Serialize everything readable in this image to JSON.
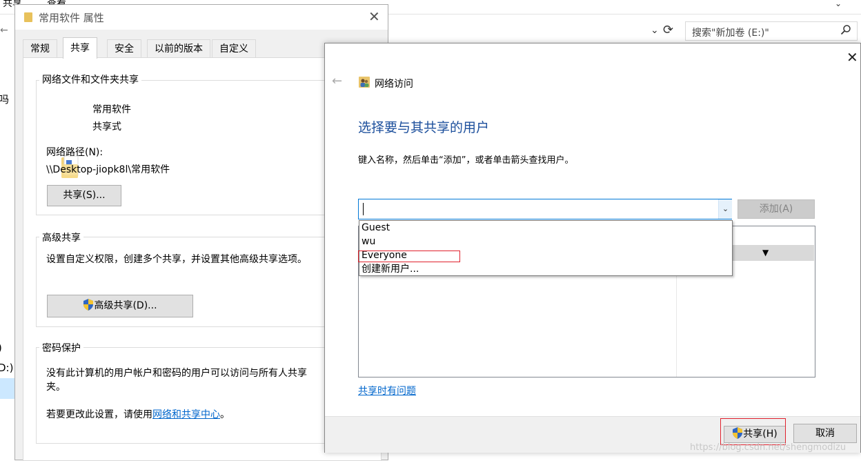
{
  "explorer": {
    "ribbon_tabs": [
      "共享",
      "查看"
    ],
    "search_placeholder": "搜索\"新加卷 (E:)\"",
    "sidebar_fragments": [
      "吗",
      ")",
      "D:)"
    ]
  },
  "properties": {
    "title": "常用软件 属性",
    "tabs": [
      "常规",
      "共享",
      "安全",
      "以前的版本",
      "自定义"
    ],
    "active_tab": "共享",
    "network_sharing": {
      "group_label": "网络文件和文件夹共享",
      "folder_name": "常用软件",
      "share_state": "共享式",
      "path_label": "网络路径(N):",
      "path_value": "\\\\Desktop-jiopk8l\\常用软件",
      "share_button": "共享(S)..."
    },
    "advanced": {
      "group_label": "高级共享",
      "description": "设置自定义权限，创建多个共享，并设置其他高级共享选项。",
      "button": "高级共享(D)..."
    },
    "password": {
      "group_label": "密码保护",
      "desc_line1": "没有此计算机的用户帐户和密码的用户可以访问与所有人共享",
      "desc_line2": "夹。",
      "change_prefix": "若要更改此设置，请使用",
      "change_link": "网络和共享中心",
      "change_suffix": "。"
    }
  },
  "network_access": {
    "title": "网络访问",
    "heading": "选择要与其共享的用户",
    "instruction": "键入名称，然后单击“添加”，或者单击箭头查找用户。",
    "input_value": "",
    "add_button": "添加(A)",
    "dropdown_options": [
      "Guest",
      "wu",
      "Everyone",
      "创建新用户..."
    ],
    "highlighted_option": "Everyone",
    "trouble_link": "共享时有问题",
    "share_button": "共享(H)",
    "cancel_button": "取消"
  },
  "watermark": "https://blog.csdn.net/shengmodizu",
  "colors": {
    "heading_blue": "#1c4f9c",
    "link_blue": "#0066cc",
    "highlight_red": "#e0202c",
    "focus_blue": "#0078d7"
  }
}
